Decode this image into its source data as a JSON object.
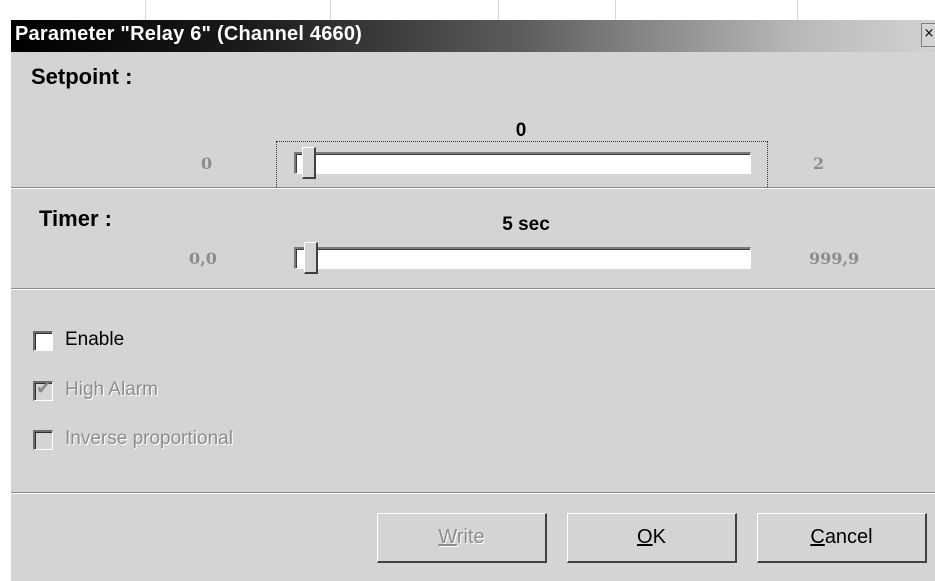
{
  "window": {
    "title": "Parameter \"Relay 6\" (Channel 4660)",
    "close_glyph": "×"
  },
  "setpoint": {
    "label": "Setpoint :",
    "min": "0",
    "max": "2",
    "current": "0",
    "position_fraction": 0.0
  },
  "timer": {
    "label": "Timer :",
    "min": "0,0",
    "max": "999,9",
    "current": "5 sec",
    "position_fraction": 0.005
  },
  "options": [
    {
      "label": "Enable",
      "checked": false,
      "enabled": true
    },
    {
      "label": "High Alarm",
      "checked": true,
      "enabled": false
    },
    {
      "label": "Inverse proportional",
      "checked": false,
      "enabled": false
    }
  ],
  "buttons": {
    "write": {
      "mnemonic": "W",
      "rest": "rite",
      "enabled": false
    },
    "ok": {
      "mnemonic": "O",
      "rest": "K",
      "enabled": true
    },
    "cancel": {
      "mnemonic": "C",
      "rest": "ancel",
      "enabled": true
    }
  },
  "icons": [
    "close-icon",
    "check-icon"
  ]
}
